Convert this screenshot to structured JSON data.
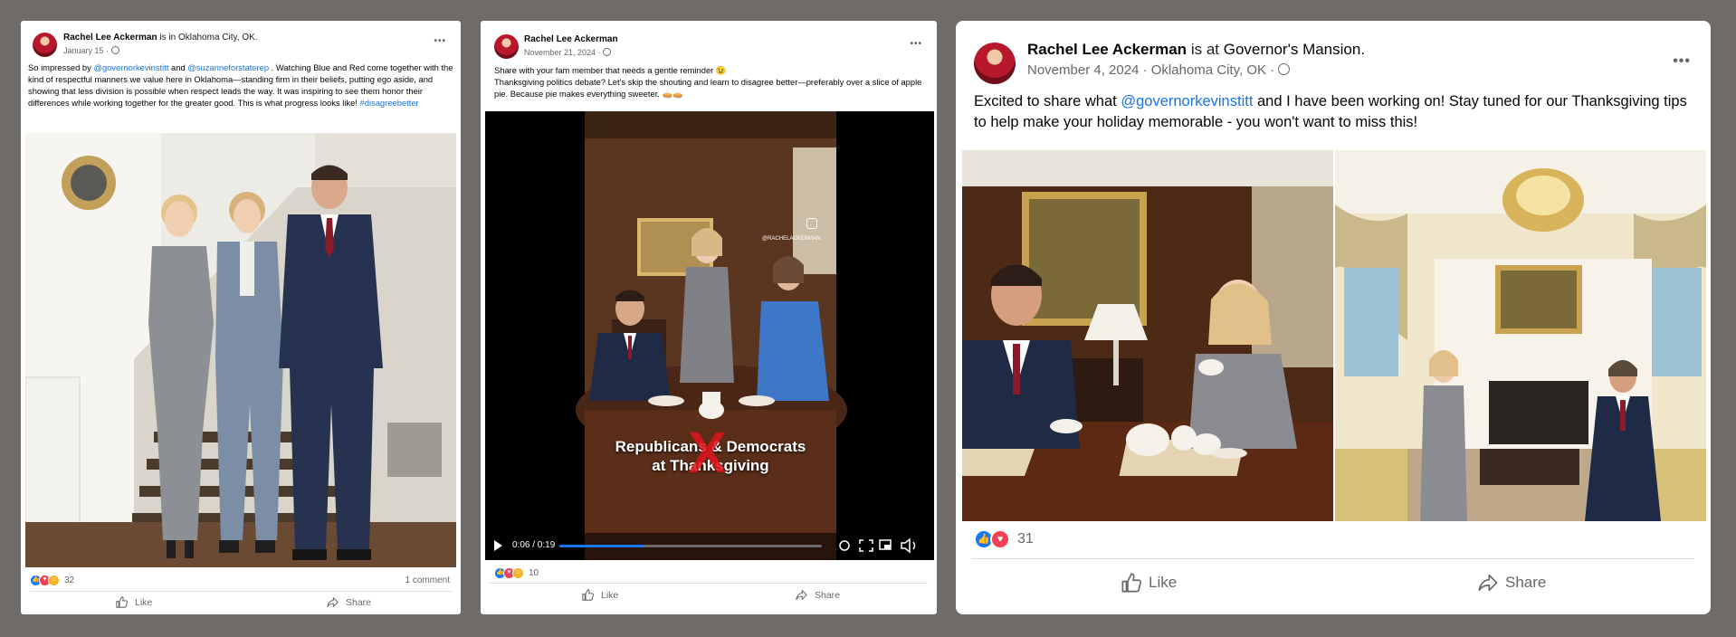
{
  "posts": [
    {
      "author": "Rachel Lee Ackerman",
      "location_prefix": "is in",
      "location": "Oklahoma City, OK.",
      "date": "January 15 ·",
      "menu": "•••",
      "text_parts": {
        "t1": "So impressed by ",
        "mention1": "@governorkevinstitt",
        "t2": " and ",
        "mention2": "@suzanneforstaterep",
        "t3": " . Watching Blue and Red come together with the kind of respectful manners we value here in Oklahoma—standing firm in their beliefs, putting ego aside, and showing that less division is possible when respect leads the way. It was inspiring to see them honor their differences while working together for the greater good. This is what progress looks like! ",
        "hashtag": "#disagreebetter"
      },
      "reaction_count": "32",
      "comments": "1 comment",
      "like_label": "Like",
      "share_label": "Share"
    },
    {
      "author": "Rachel Lee Ackerman",
      "date": "November 21, 2024 ·",
      "menu": "•••",
      "text_line1": "Share with your fam member that needs a gentle reminder 😉",
      "text_line2": "Thanksgiving politics debate? Let's skip the shouting and learn to disagree better—preferably over a slice of apple pie. Because pie makes everything sweeter. 🥧🥧",
      "video": {
        "caption_line1": "Republicans & Democrats",
        "caption_line2": "at Thanksgiving",
        "cross": "X",
        "watermark": "@RACHELACKERMAN",
        "time": "0:06 / 0:19",
        "progress": 0.32
      },
      "reaction_count": "10",
      "like_label": "Like",
      "share_label": "Share"
    },
    {
      "author": "Rachel Lee Ackerman",
      "location_prefix": "is at",
      "location": "Governor's Mansion.",
      "date": "November 4, 2024 · Oklahoma City, OK ·",
      "menu": "•••",
      "text_parts": {
        "t1": "Excited to share what ",
        "mention1": "@governorkevinstitt",
        "t2": " and I have been working on! Stay tuned for our Thanksgiving tips to help make your holiday memorable - you won't want to miss this!"
      },
      "reaction_count": "31",
      "like_label": "Like",
      "share_label": "Share"
    }
  ],
  "colors": {
    "background": "#6f6b69",
    "link": "#1b74e4",
    "like_blue": "#1877f2",
    "love_red": "#f33e58"
  }
}
